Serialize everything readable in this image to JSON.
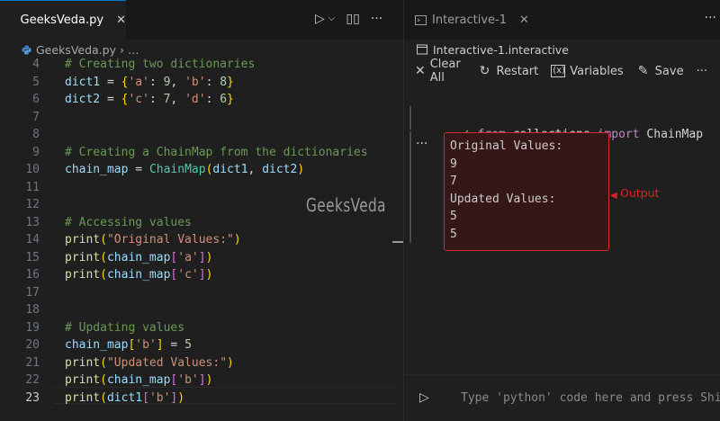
{
  "editor": {
    "tab_label": "GeeksVeda.py",
    "breadcrumb": [
      "GeeksVeda.py",
      "…"
    ],
    "lines": [
      {
        "n": "4",
        "tokens": [
          [
            "cmt",
            "# Creating two dictionaries"
          ]
        ]
      },
      {
        "n": "5",
        "tokens": [
          [
            "var",
            "dict1"
          ],
          [
            "op",
            " = "
          ],
          [
            "b1",
            "{"
          ],
          [
            "str",
            "'a'"
          ],
          [
            "op",
            ": "
          ],
          [
            "num",
            "9"
          ],
          [
            "op",
            ", "
          ],
          [
            "str",
            "'b'"
          ],
          [
            "op",
            ": "
          ],
          [
            "num",
            "8"
          ],
          [
            "b1",
            "}"
          ]
        ]
      },
      {
        "n": "6",
        "tokens": [
          [
            "var",
            "dict2"
          ],
          [
            "op",
            " = "
          ],
          [
            "b1",
            "{"
          ],
          [
            "str",
            "'c'"
          ],
          [
            "op",
            ": "
          ],
          [
            "num",
            "7"
          ],
          [
            "op",
            ", "
          ],
          [
            "str",
            "'d'"
          ],
          [
            "op",
            ": "
          ],
          [
            "num",
            "6"
          ],
          [
            "b1",
            "}"
          ]
        ]
      },
      {
        "n": "7",
        "tokens": []
      },
      {
        "n": "8",
        "tokens": []
      },
      {
        "n": "9",
        "tokens": [
          [
            "cmt",
            "# Creating a ChainMap from the dictionaries"
          ]
        ]
      },
      {
        "n": "10",
        "tokens": [
          [
            "var",
            "chain_map"
          ],
          [
            "op",
            " = "
          ],
          [
            "cls",
            "ChainMap"
          ],
          [
            "b1",
            "("
          ],
          [
            "var",
            "dict1"
          ],
          [
            "op",
            ", "
          ],
          [
            "var",
            "dict2"
          ],
          [
            "b1",
            ")"
          ]
        ]
      },
      {
        "n": "11",
        "tokens": []
      },
      {
        "n": "12",
        "tokens": []
      },
      {
        "n": "13",
        "tokens": [
          [
            "cmt",
            "# Accessing values"
          ]
        ]
      },
      {
        "n": "14",
        "tokens": [
          [
            "fn",
            "print"
          ],
          [
            "b1",
            "("
          ],
          [
            "str",
            "\"Original Values:\""
          ],
          [
            "b1",
            ")"
          ]
        ]
      },
      {
        "n": "15",
        "tokens": [
          [
            "fn",
            "print"
          ],
          [
            "b1",
            "("
          ],
          [
            "var",
            "chain_map"
          ],
          [
            "b2",
            "["
          ],
          [
            "str",
            "'a'"
          ],
          [
            "b2",
            "]"
          ],
          [
            "b1",
            ")"
          ]
        ]
      },
      {
        "n": "16",
        "tokens": [
          [
            "fn",
            "print"
          ],
          [
            "b1",
            "("
          ],
          [
            "var",
            "chain_map"
          ],
          [
            "b2",
            "["
          ],
          [
            "str",
            "'c'"
          ],
          [
            "b2",
            "]"
          ],
          [
            "b1",
            ")"
          ]
        ]
      },
      {
        "n": "17",
        "tokens": []
      },
      {
        "n": "18",
        "tokens": []
      },
      {
        "n": "19",
        "tokens": [
          [
            "cmt",
            "# Updating values"
          ]
        ]
      },
      {
        "n": "20",
        "tokens": [
          [
            "var",
            "chain_map"
          ],
          [
            "b1",
            "["
          ],
          [
            "str",
            "'b'"
          ],
          [
            "b1",
            "]"
          ],
          [
            "op",
            " = "
          ],
          [
            "num",
            "5"
          ]
        ]
      },
      {
        "n": "21",
        "tokens": [
          [
            "fn",
            "print"
          ],
          [
            "b1",
            "("
          ],
          [
            "str",
            "\"Updated Values:\""
          ],
          [
            "b1",
            ")"
          ]
        ]
      },
      {
        "n": "22",
        "tokens": [
          [
            "fn",
            "print"
          ],
          [
            "b1",
            "("
          ],
          [
            "var",
            "chain_map"
          ],
          [
            "b2",
            "["
          ],
          [
            "str",
            "'b'"
          ],
          [
            "b2",
            "]"
          ],
          [
            "b1",
            ")"
          ]
        ]
      },
      {
        "n": "23",
        "tokens": [
          [
            "fn",
            "print"
          ],
          [
            "b1",
            "("
          ],
          [
            "var",
            "dict1"
          ],
          [
            "b2",
            "["
          ],
          [
            "str",
            "'b'"
          ],
          [
            "b2",
            "]"
          ],
          [
            "b1",
            ")"
          ]
        ]
      }
    ],
    "active_line": "23",
    "watermark": "GeeksVeda"
  },
  "interactive": {
    "tab_label": "Interactive-1",
    "breadcrumb": "Interactive-1.interactive",
    "toolbar": {
      "clear_all": "Clear All",
      "restart": "Restart",
      "variables": "Variables",
      "save": "Save",
      "more": "···"
    },
    "input_cell": {
      "kw_from": "from",
      "module": " collections ",
      "kw_import": "import",
      "name": " ChainMap"
    },
    "output_lines": [
      "Original Values:",
      "9",
      "7",
      "Updated Values:",
      "5",
      "5"
    ],
    "output_annotation": "Output",
    "repl_placeholder": "Type 'python' code here and press Shi"
  },
  "colors": {
    "accent": "#0078d4",
    "annotation_red": "#e02020",
    "success_green": "#89d185"
  }
}
